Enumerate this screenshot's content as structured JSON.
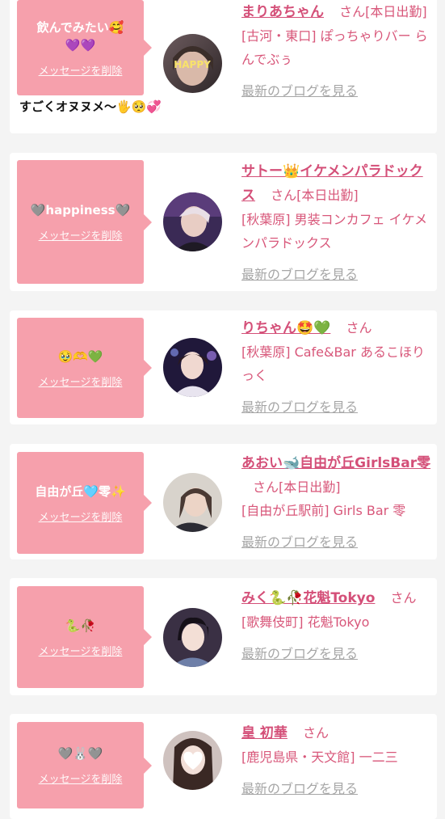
{
  "cards": [
    {
      "message": "飲んでみたい🥰💜💜",
      "delete_label": "メッセージを削除",
      "name": "まりあちゃん",
      "san": "さん",
      "status": "[本日出勤]",
      "area": "[古河・東口] ぽっちゃりバー らんでぶぅ",
      "blog_label": "最新のブログを見る",
      "avatar_text": "HAPPY",
      "extra_comment": "すごくオヌヌメ〜🖐🥺💞"
    },
    {
      "message": "🩶happiness🩶",
      "delete_label": "メッセージを削除",
      "name": "サトー👑イケメンパラドックス",
      "san": "さん",
      "status": "[本日出勤]",
      "area": "[秋葉原] 男装コンカフェ イケメンパラドックス",
      "blog_label": "最新のブログを見る"
    },
    {
      "message": "🥹🫶💚",
      "delete_label": "メッセージを削除",
      "name": "りちゃん🤩💚",
      "san": "さん",
      "status": "",
      "area": "[秋葉原] Cafe&Bar あるこほりっく",
      "blog_label": "最新のブログを見る"
    },
    {
      "message": "自由が丘🩵零✨",
      "delete_label": "メッセージを削除",
      "name": "あおい🐋自由が丘GirlsBar零",
      "san": "さん",
      "status": "[本日出勤]",
      "area": "[自由が丘駅前] Girls Bar 零",
      "blog_label": "最新のブログを見る"
    },
    {
      "message": "🐍🥀",
      "delete_label": "メッセージを削除",
      "name": "みく🐍🥀花魁Tokyo",
      "san": "さん",
      "status": "",
      "area": "[歌舞伎町] 花魁Tokyo",
      "blog_label": "最新のブログを見る"
    },
    {
      "message": "🩶🐰🩶",
      "delete_label": "メッセージを削除",
      "name": "皇 初華",
      "san": "さん",
      "status": "",
      "area": "[鹿児島県・天文館] 一二三",
      "blog_label": "最新のブログを見る"
    }
  ],
  "colors": {
    "bubble": "#f6a0ac",
    "name": "#d44f78",
    "blog_link": "#a6a6a6",
    "background": "#f4f4f4"
  }
}
